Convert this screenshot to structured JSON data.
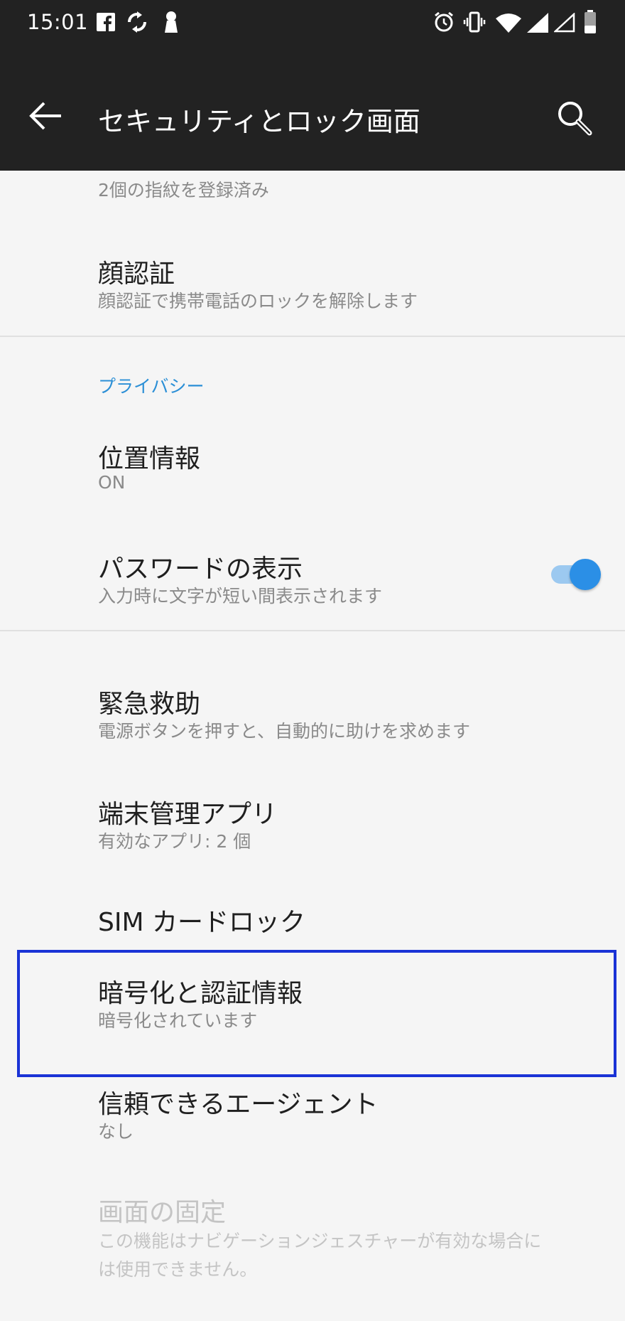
{
  "status_bar": {
    "time": "15:01",
    "left_icons": [
      "facebook-icon",
      "sync-icon",
      "keyhole-icon"
    ],
    "right_icons": [
      "alarm-icon",
      "vibrate-icon",
      "wifi-icon",
      "signal-icon",
      "signal-empty-icon",
      "battery-icon"
    ]
  },
  "app_bar": {
    "title": "セキュリティとロック画面",
    "back_icon": "arrow-left-icon",
    "search_icon": "search-icon"
  },
  "items": {
    "fingerprint": {
      "subtitle": "2個の指紋を登録済み"
    },
    "face_unlock": {
      "title": "顔認証",
      "subtitle": "顔認証で携帯電話のロックを解除します"
    },
    "privacy_header": "プライバシー",
    "location": {
      "title": "位置情報",
      "subtitle": "ON"
    },
    "show_password": {
      "title": "パスワードの表示",
      "subtitle": "入力時に文字が短い間表示されます",
      "toggle_on": true
    },
    "emergency_rescue": {
      "title": "緊急救助",
      "subtitle": "電源ボタンを押すと、自動的に助けを求めます"
    },
    "device_admin": {
      "title": "端末管理アプリ",
      "subtitle": "有効なアプリ: 2 個"
    },
    "sim_lock": {
      "title": "SIM カードロック"
    },
    "encryption": {
      "title": "暗号化と認証情報",
      "subtitle": "暗号化されています"
    },
    "trust_agents": {
      "title": "信頼できるエージェント",
      "subtitle": "なし"
    },
    "screen_pinning": {
      "title": "画面の固定",
      "subtitle_line1": "この機能はナビゲーションジェスチャーが有効な場合に",
      "subtitle_line2": "は使用できません。"
    }
  },
  "colors": {
    "app_bar_bg": "#222222",
    "content_bg": "#f5f5f5",
    "accent": "#2b8fd6",
    "highlight_border": "#1a33d6"
  }
}
